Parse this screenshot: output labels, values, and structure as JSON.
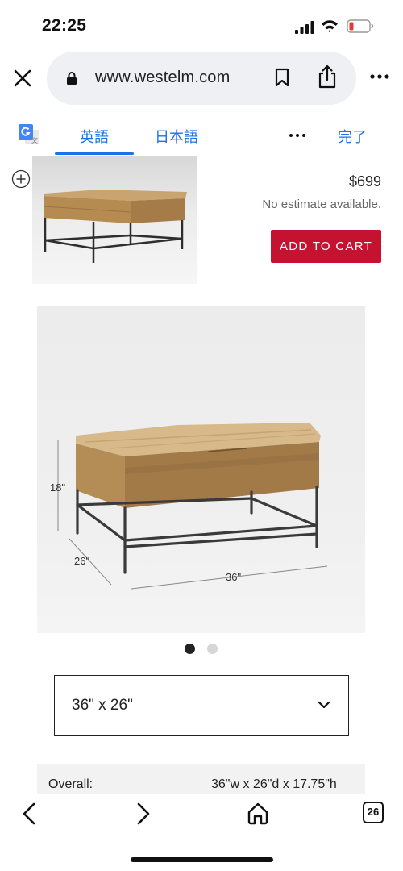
{
  "status_bar": {
    "time": "22:25",
    "icons": [
      "signal-icon",
      "wifi-icon",
      "battery-icon"
    ],
    "battery_color": "#e53935"
  },
  "browser": {
    "url": "www.westelm.com",
    "icons": [
      "close-icon",
      "lock-icon",
      "bookmark-icon",
      "share-icon",
      "more-icon"
    ]
  },
  "translate_bar": {
    "tabs": [
      {
        "label": "英語",
        "selected": true
      },
      {
        "label": "日本語",
        "selected": false
      }
    ],
    "done_label": "完了",
    "accent": "#1a73e8"
  },
  "sticky_bar": {
    "price": "$699",
    "estimate": "No estimate available.",
    "add_to_cart_label": "ADD TO CART",
    "button_color": "#c41230"
  },
  "product_image": {
    "dimension_labels": {
      "height": "18\"",
      "depth": "26\"",
      "width": "36\""
    }
  },
  "carousel": {
    "current_page": 1,
    "total_pages": 2
  },
  "size_select": {
    "value": "36\" x 26\""
  },
  "specs": {
    "overall_label": "Overall:",
    "overall_value": "36\"w x 26\"d x 17.75\"h"
  },
  "toolbar": {
    "tab_count": "26",
    "icons": [
      "back-icon",
      "forward-icon",
      "home-icon",
      "tabs-icon"
    ]
  }
}
